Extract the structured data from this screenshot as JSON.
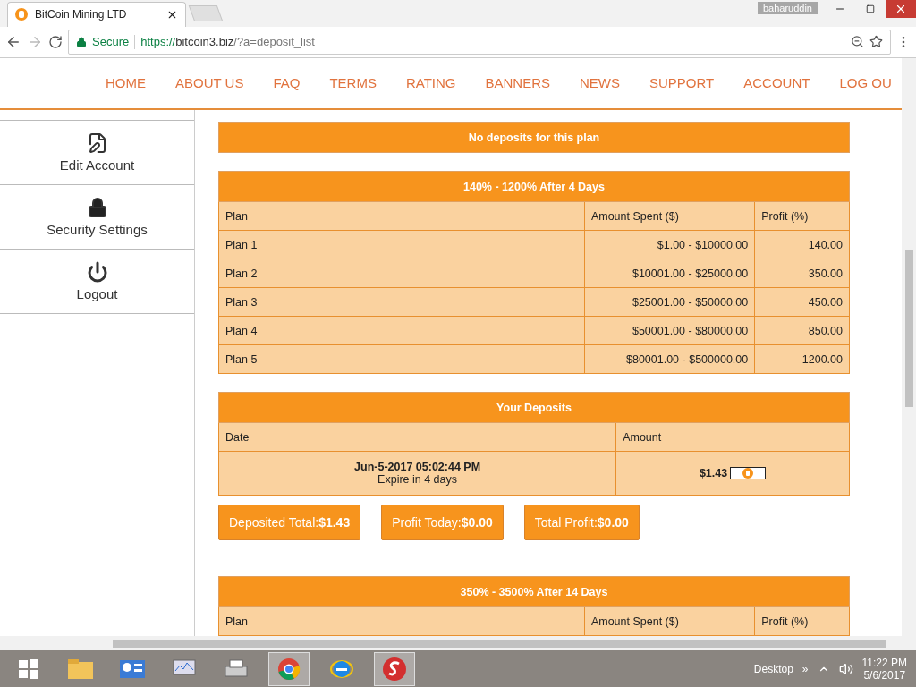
{
  "browser": {
    "tab_title": "BitCoin Mining LTD",
    "profile": "baharuddin",
    "secure_label": "Secure",
    "url_scheme": "https://",
    "url_domain": "bitcoin3.biz",
    "url_path": "/?a=deposit_list"
  },
  "nav": [
    "HOME",
    "ABOUT US",
    "FAQ",
    "TERMS",
    "RATING",
    "BANNERS",
    "NEWS",
    "SUPPORT",
    "ACCOUNT",
    "LOG OU"
  ],
  "sidebar": [
    {
      "label": "Edit Account",
      "kind": "edit"
    },
    {
      "label": "Security Settings",
      "kind": "lock"
    },
    {
      "label": "Logout",
      "kind": "power"
    }
  ],
  "sections": [
    {
      "kind": "notice",
      "title": "No deposits for this plan"
    },
    {
      "kind": "plans",
      "title": "140% - 1200% After 4 Days",
      "columns": [
        "Plan",
        "Amount Spent ($)",
        "Profit (%)"
      ],
      "rows": [
        {
          "plan": "Plan 1",
          "amount": "$1.00 - $10000.00",
          "profit": "140.00"
        },
        {
          "plan": "Plan 2",
          "amount": "$10001.00 - $25000.00",
          "profit": "350.00"
        },
        {
          "plan": "Plan 3",
          "amount": "$25001.00 - $50000.00",
          "profit": "450.00"
        },
        {
          "plan": "Plan 4",
          "amount": "$50001.00 - $80000.00",
          "profit": "850.00"
        },
        {
          "plan": "Plan 5",
          "amount": "$80001.00 - $500000.00",
          "profit": "1200.00"
        }
      ]
    },
    {
      "kind": "deposits",
      "title": "Your Deposits",
      "columns": [
        "Date",
        "Amount"
      ],
      "rows": [
        {
          "date": "Jun-5-2017 05:02:44 PM",
          "expire": "Expire in 4 days",
          "amount": "$1.43"
        }
      ]
    },
    {
      "kind": "totals",
      "items": [
        {
          "label": "Deposited Total:",
          "value": "$1.43"
        },
        {
          "label": "Profit Today:",
          "value": "$0.00"
        },
        {
          "label": "Total Profit:",
          "value": "$0.00"
        }
      ]
    },
    {
      "kind": "plans",
      "title": "350% - 3500% After 14 Days",
      "columns": [
        "Plan",
        "Amount Spent ($)",
        "Profit (%)"
      ]
    }
  ],
  "taskbar": {
    "desktop": "Desktop",
    "chevron": "»",
    "time": "11:22 PM",
    "date": "5/6/2017"
  }
}
